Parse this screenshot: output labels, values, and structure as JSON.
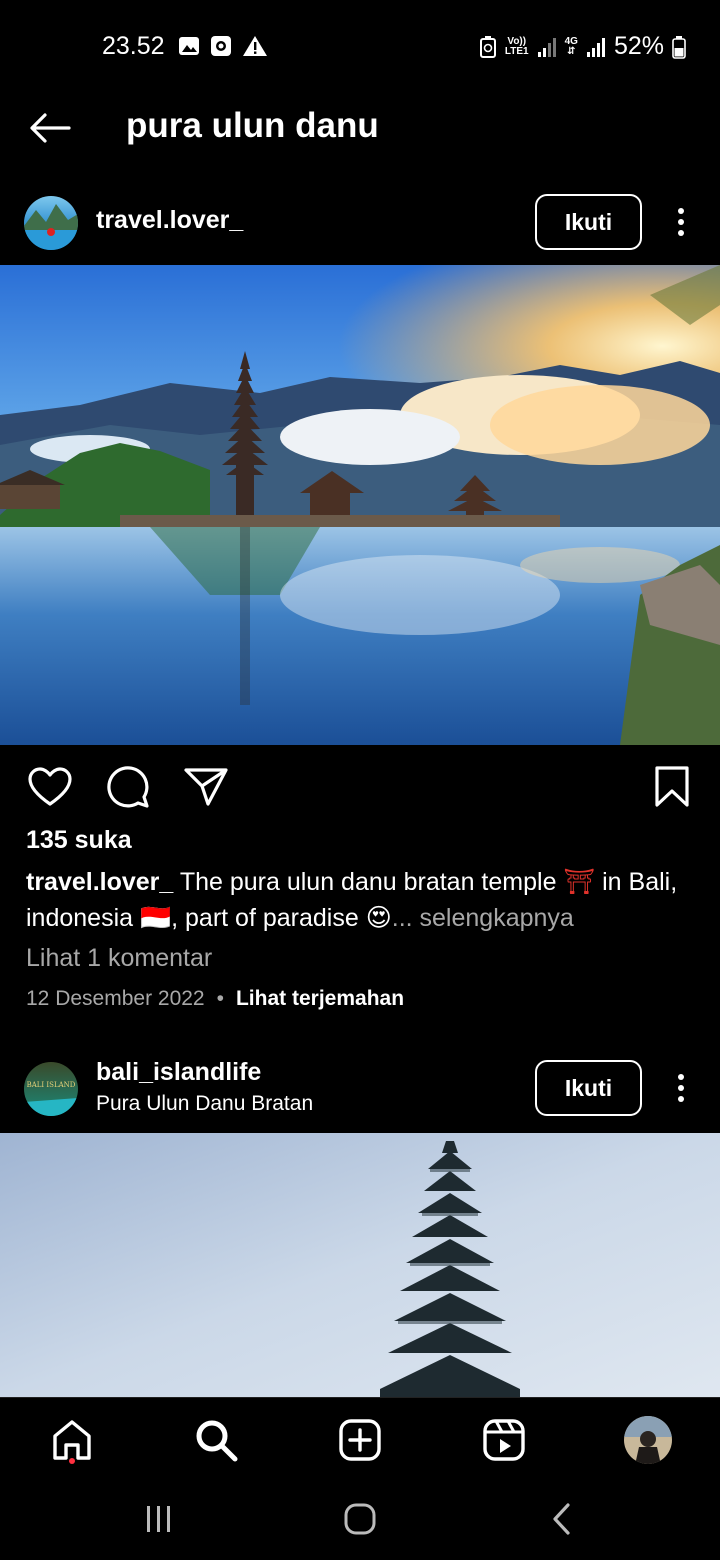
{
  "status_bar": {
    "time": "23.52",
    "volte_label": "Vo))",
    "lte_label": "LTE1",
    "network_label": "4G",
    "battery": "52%",
    "icons": [
      "gallery-icon",
      "screen-record-icon",
      "warning-icon",
      "recycle-icon",
      "signal-icon",
      "battery-icon"
    ]
  },
  "header": {
    "title": "pura ulun danu"
  },
  "post1": {
    "username": "travel.lover_",
    "follow_label": "Ikuti",
    "likes": "135 suka",
    "caption_user": "travel.lover_",
    "caption_text_1": " The pura ulun danu bratan temple ",
    "caption_emoji_1": "⛩",
    "caption_text_2": " in Bali, indonesia ",
    "caption_emoji_2": "🇮🇩",
    "caption_text_3": ", part of paradise ",
    "caption_emoji_3": "😍",
    "caption_more": "... selengkapnya",
    "comments": "Lihat 1 komentar",
    "date": "12 Desember 2022",
    "separator": "•",
    "translate": "Lihat terjemahan"
  },
  "post2": {
    "username": "bali_islandlife",
    "location": "Pura Ulun Danu Bratan",
    "follow_label": "Ikuti",
    "avatar_text": "BALI ISLAND"
  },
  "colors": {
    "background": "#000000",
    "text": "#ffffff",
    "muted": "#a8a8a8",
    "notification": "#ff3040",
    "torii": "#e0322b"
  }
}
